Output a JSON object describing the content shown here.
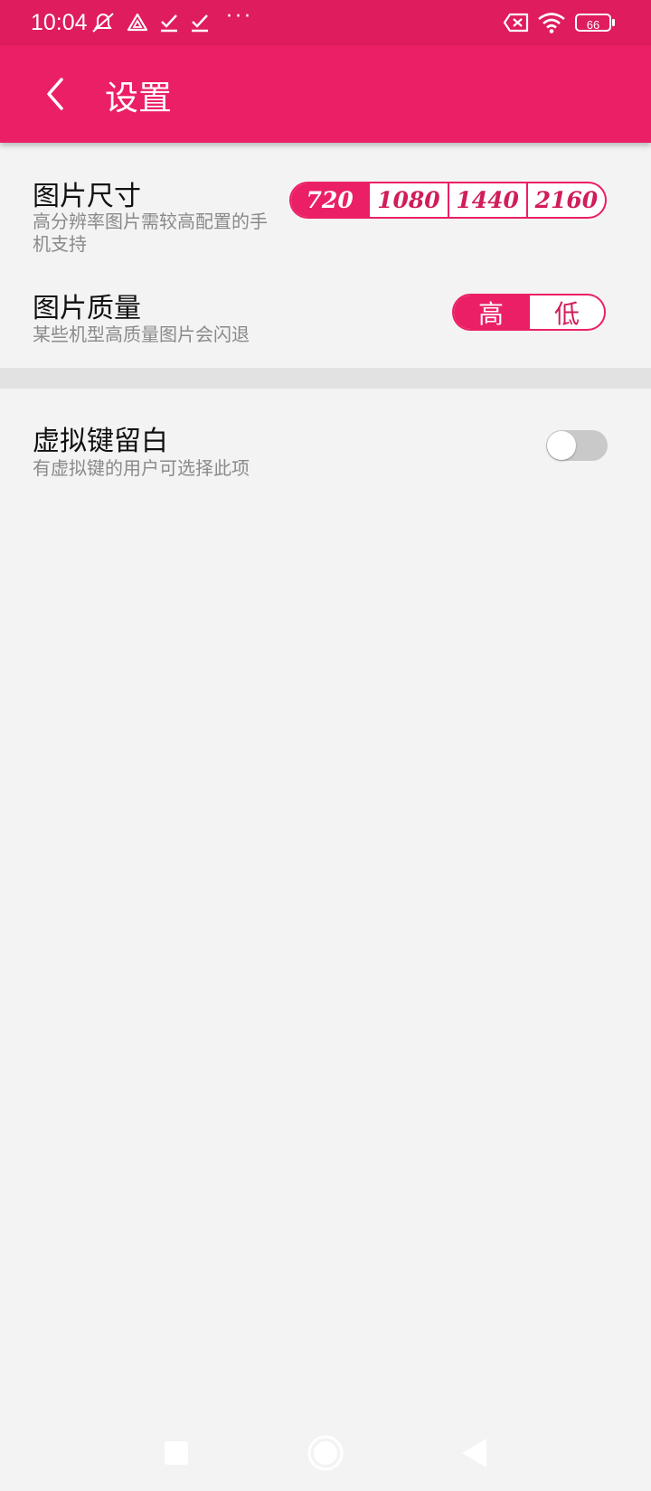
{
  "status_bar": {
    "time": "10:04",
    "battery": "66",
    "icons": [
      "muted-bell-icon",
      "vpn-triangle-icon",
      "check-download-icon",
      "check-download-icon",
      "more-dots-icon",
      "sim-x-icon",
      "wifi-icon",
      "battery-icon"
    ],
    "more": "···"
  },
  "app_bar": {
    "title": "设置",
    "background": "#eb1f66"
  },
  "settings": {
    "image_size": {
      "title": "图片尺寸",
      "desc": "高分辨率图片需较高配置的手机支持",
      "options": [
        "720",
        "1080",
        "1440",
        "2160"
      ],
      "selected": "720"
    },
    "image_quality": {
      "title": "图片质量",
      "desc": "某些机型高质量图片会闪退",
      "options": [
        "高",
        "低"
      ],
      "selected": "高"
    },
    "virtual_keys": {
      "title": "虚拟键留白",
      "desc": "有虚拟键的用户可选择此项",
      "enabled": false
    }
  },
  "nav_bar": {
    "icons": [
      "recents-square-icon",
      "home-circle-icon",
      "back-triangle-icon"
    ]
  }
}
